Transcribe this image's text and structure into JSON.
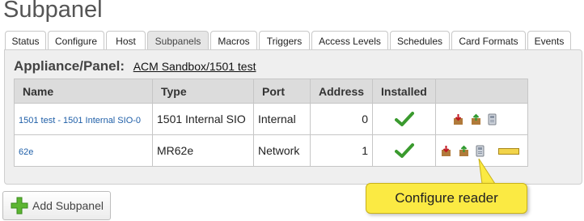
{
  "page": {
    "title": "Subpanel"
  },
  "tabs": [
    {
      "label": "Status",
      "active": false
    },
    {
      "label": "Configure",
      "active": false
    },
    {
      "label": "Host",
      "active": false
    },
    {
      "label": "Subpanels",
      "active": true
    },
    {
      "label": "Macros",
      "active": false
    },
    {
      "label": "Triggers",
      "active": false
    },
    {
      "label": "Access Levels",
      "active": false
    },
    {
      "label": "Schedules",
      "active": false
    },
    {
      "label": "Card Formats",
      "active": false
    },
    {
      "label": "Events",
      "active": false
    }
  ],
  "panel": {
    "heading": "Appliance/Panel:",
    "appliance_link": "ACM Sandbox/1501 test"
  },
  "table": {
    "columns": [
      "Name",
      "Type",
      "Port",
      "Address",
      "Installed",
      ""
    ],
    "rows": [
      {
        "name": "1501 test - 1501 Internal SIO-0",
        "type": "1501 Internal SIO",
        "port": "Internal",
        "address": "0",
        "installed": true,
        "actions": [
          "delete-box-icon",
          "edit-box-icon",
          "reader-config-icon"
        ]
      },
      {
        "name": "62e",
        "type": "MR62e",
        "port": "Network",
        "address": "1",
        "installed": true,
        "actions": [
          "delete-box-icon",
          "edit-box-icon",
          "reader-config-icon",
          "status-bar-icon"
        ]
      }
    ]
  },
  "tooltip": {
    "text": "Configure reader"
  },
  "add_button": {
    "label": "Add Subpanel",
    "icon": "plus-icon"
  },
  "colors": {
    "tooltip_bg": "#fbea43",
    "check_green": "#3a9a2e",
    "link": "#1f5fa8"
  }
}
